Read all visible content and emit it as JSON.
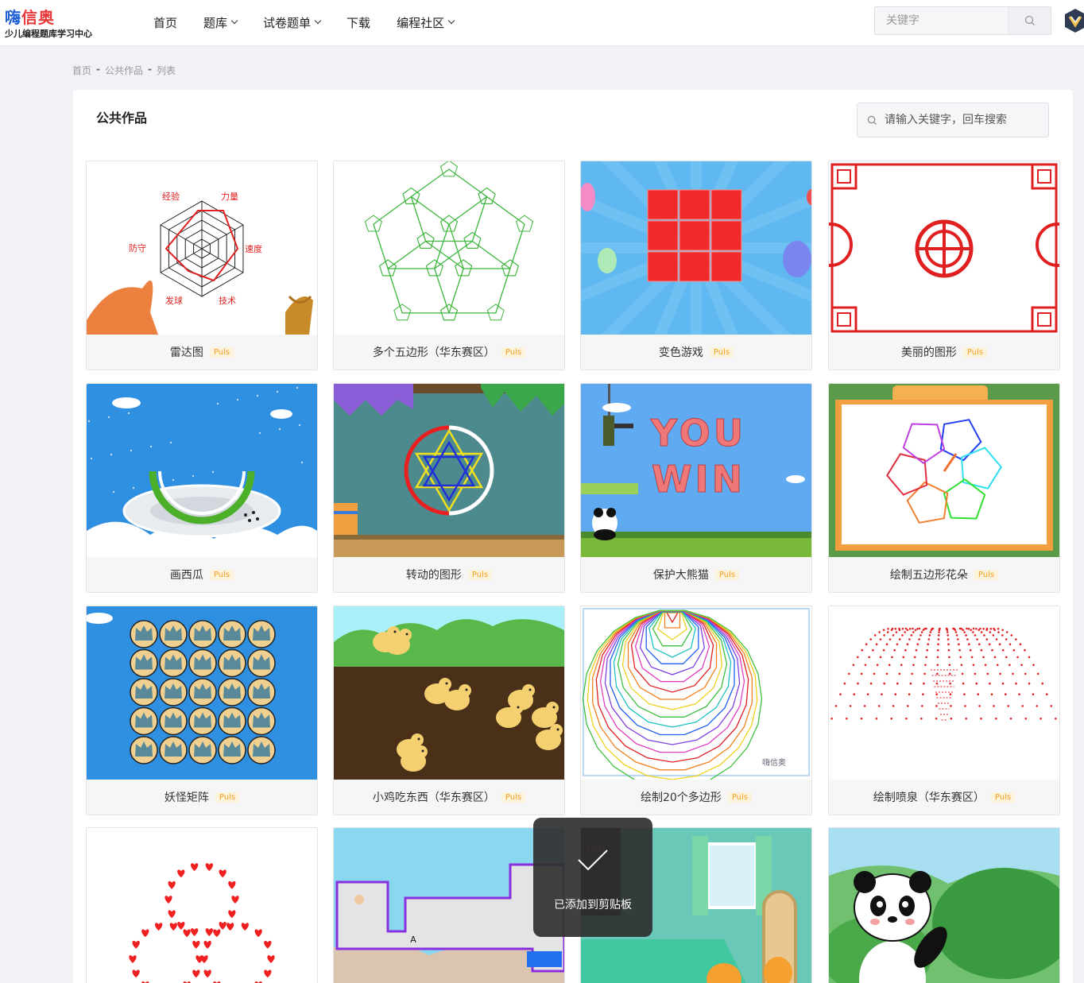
{
  "header": {
    "logo_text_a": "嗨",
    "logo_text_b": "信奥",
    "logo_sub": "少儿编程题库学习中心",
    "nav": [
      {
        "label": "首页",
        "dropdown": false
      },
      {
        "label": "题库",
        "dropdown": true
      },
      {
        "label": "试卷题单",
        "dropdown": true
      },
      {
        "label": "下载",
        "dropdown": false
      },
      {
        "label": "编程社区",
        "dropdown": true
      }
    ],
    "search_placeholder": "关键字"
  },
  "breadcrumb": [
    "首页",
    "公共作品",
    "列表"
  ],
  "main": {
    "title": "公共作品",
    "search_placeholder": "请输入关键字，回车搜索"
  },
  "cards": [
    {
      "title": "雷达图",
      "badge": "Puls",
      "thumb": "radar"
    },
    {
      "title": "多个五边形（华东赛区）",
      "badge": "Puls",
      "thumb": "pentagons"
    },
    {
      "title": "变色游戏",
      "badge": "Puls",
      "thumb": "colorgame"
    },
    {
      "title": "美丽的图形",
      "badge": "Puls",
      "thumb": "beautiful"
    },
    {
      "title": "画西瓜",
      "badge": "Puls",
      "thumb": "watermelon"
    },
    {
      "title": "转动的图形",
      "badge": "Puls",
      "thumb": "rotating"
    },
    {
      "title": "保护大熊猫",
      "badge": "Puls",
      "thumb": "panda-game"
    },
    {
      "title": "绘制五边形花朵",
      "badge": "Puls",
      "thumb": "pentaflower"
    },
    {
      "title": "妖怪矩阵",
      "badge": "Puls",
      "thumb": "monsters"
    },
    {
      "title": "小鸡吃东西（华东赛区）",
      "badge": "Puls",
      "thumb": "chicks"
    },
    {
      "title": "绘制20个多边形",
      "badge": "Puls",
      "thumb": "polygons"
    },
    {
      "title": "绘制喷泉（华东赛区）",
      "badge": "Puls",
      "thumb": "fountain"
    },
    {
      "title": "",
      "badge": "",
      "thumb": "hearts"
    },
    {
      "title": "",
      "badge": "",
      "thumb": "maze"
    },
    {
      "title": "",
      "badge": "",
      "thumb": "bedroom"
    },
    {
      "title": "",
      "badge": "",
      "thumb": "panda"
    }
  ],
  "radar": {
    "labels": [
      "经验",
      "力量",
      "速度",
      "技术",
      "发球",
      "防守"
    ]
  },
  "youwin": {
    "line1": "YOU",
    "line2": "WIN"
  },
  "watermark": "嗨信奥",
  "maze_label": "A",
  "toast": {
    "message": "已添加到剪贴板"
  },
  "colors": {
    "accent": "#e83a3a",
    "brand_blue": "#1f5fd6",
    "badge_text": "#f0a020"
  }
}
